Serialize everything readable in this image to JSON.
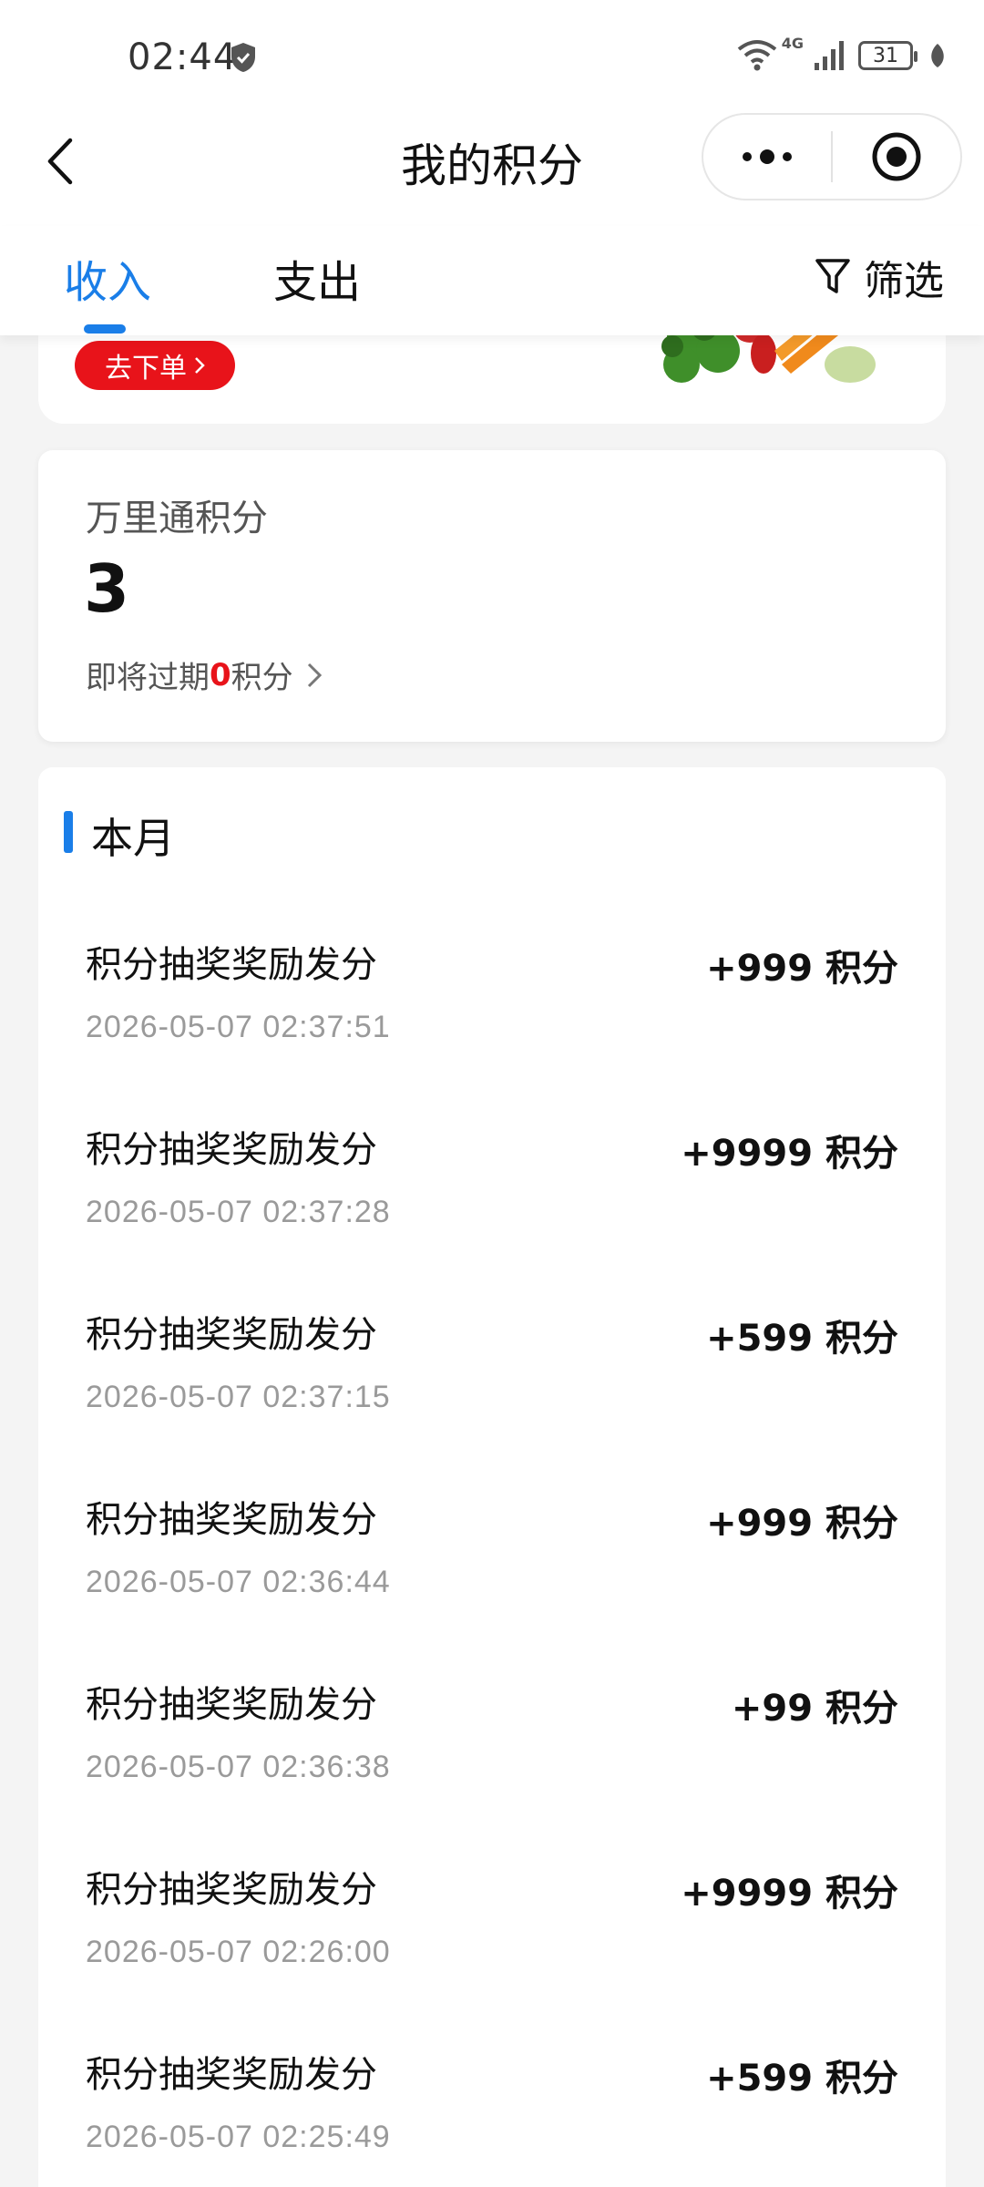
{
  "status": {
    "time": "02:44",
    "network": "4G",
    "battery": "31"
  },
  "nav": {
    "title": "我的积分"
  },
  "tabs": {
    "income": "收入",
    "expense": "支出",
    "filter": "筛选"
  },
  "banner": {
    "order_button": "去下单"
  },
  "points": {
    "label": "万里通积分",
    "value": "3",
    "expire_prefix": "即将过期",
    "expire_count": "0",
    "expire_suffix": "积分"
  },
  "list": {
    "section_title": "本月",
    "items": [
      {
        "title": "积分抽奖奖励发分",
        "time": "2026-05-07 02:37:51",
        "amount": "+999 积分"
      },
      {
        "title": "积分抽奖奖励发分",
        "time": "2026-05-07 02:37:28",
        "amount": "+9999 积分"
      },
      {
        "title": "积分抽奖奖励发分",
        "time": "2026-05-07 02:37:15",
        "amount": "+599 积分"
      },
      {
        "title": "积分抽奖奖励发分",
        "time": "2026-05-07 02:36:44",
        "amount": "+999 积分"
      },
      {
        "title": "积分抽奖奖励发分",
        "time": "2026-05-07 02:36:38",
        "amount": "+99 积分"
      },
      {
        "title": "积分抽奖奖励发分",
        "time": "2026-05-07 02:26:00",
        "amount": "+9999 积分"
      },
      {
        "title": "积分抽奖奖励发分",
        "time": "2026-05-07 02:25:49",
        "amount": "+599 积分"
      }
    ]
  },
  "colors": {
    "accent": "#1a7ee8",
    "danger": "#e8131a",
    "muted": "#9a9a9a"
  },
  "icons": [
    "shield-icon",
    "wifi-icon",
    "signal-icon",
    "battery-icon",
    "leaf-icon",
    "back-arrow-icon",
    "more-dots-icon",
    "target-icon",
    "filter-icon",
    "chevron-right-icon"
  ]
}
